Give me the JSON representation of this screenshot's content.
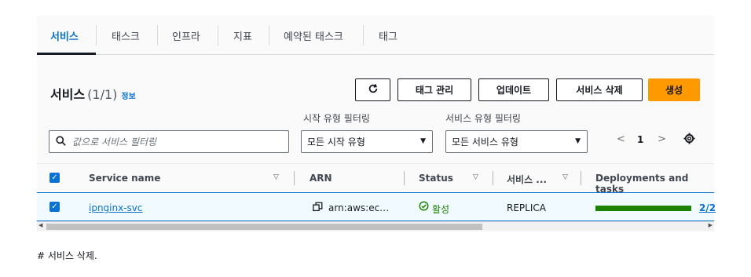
{
  "tabs": [
    {
      "label": "서비스",
      "active": true
    },
    {
      "label": "태스크"
    },
    {
      "label": "인프라"
    },
    {
      "label": "지표"
    },
    {
      "label": "예약된 태스크"
    },
    {
      "label": "태그"
    }
  ],
  "services": {
    "title": "서비스",
    "count": "(1/1)",
    "info_link": "정보",
    "buttons": {
      "refresh_icon": "refresh-icon",
      "manage_tags": "태그 관리",
      "update": "업데이트",
      "delete_service": "서비스 삭제",
      "create": "생성"
    },
    "filters": {
      "search_placeholder": "값으로 서비스 필터링",
      "launch_type_label": "시작 유형 필터링",
      "launch_type_value": "모든 시작 유형",
      "service_type_label": "서비스 유형 필터링",
      "service_type_value": "모든 서비스 유형"
    },
    "pagination": {
      "page": "1"
    },
    "table": {
      "columns": [
        "Service name",
        "ARN",
        "Status",
        "서비스 ...",
        "Deployments and tasks"
      ],
      "rows": [
        {
          "service_name": "ipnginx-svc",
          "arn": "arn:aws:ec…",
          "status": "활성",
          "service_type": "REPLICA",
          "deployment_progress": 1.0,
          "tasks": "2/2"
        }
      ]
    }
  },
  "note": "# 서비스 삭제."
}
